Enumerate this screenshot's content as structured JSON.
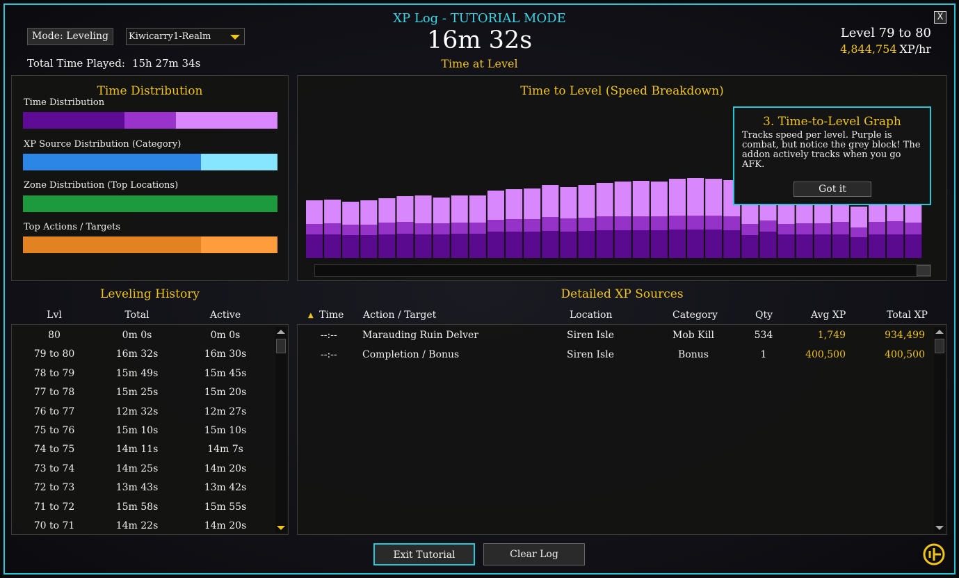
{
  "window": {
    "close_label": "X"
  },
  "header": {
    "title": "XP Log - TUTORIAL MODE",
    "time": "16m 32s",
    "subtitle": "Time at Level",
    "level_range": "Level 79 to 80",
    "xp_per_hour_value": "4,844,754",
    "xp_per_hour_unit": "XP/hr"
  },
  "controls": {
    "mode_label": "Mode: Leveling",
    "realm_selected": "Kiwicarry1-Realm",
    "total_played_label": "Total Time Played:",
    "total_played_value": "15h 27m 34s"
  },
  "distribution": {
    "title": "Time Distribution",
    "bars": [
      {
        "label": "Time Distribution",
        "segments": [
          {
            "fraction": 0.4,
            "color": "#5e0b96"
          },
          {
            "fraction": 0.2,
            "color": "#9a33cc"
          },
          {
            "fraction": 0.4,
            "color": "#da86ff"
          }
        ]
      },
      {
        "label": "XP Source Distribution (Category)",
        "segments": [
          {
            "fraction": 0.7,
            "color": "#2c86e6"
          },
          {
            "fraction": 0.3,
            "color": "#86e5ff"
          }
        ]
      },
      {
        "label": "Zone Distribution (Top Locations)",
        "segments": [
          {
            "fraction": 1.0,
            "color": "#1d9a3e"
          }
        ]
      },
      {
        "label": "Top Actions / Targets",
        "segments": [
          {
            "fraction": 0.7,
            "color": "#e38220"
          },
          {
            "fraction": 0.3,
            "color": "#ff9d3c"
          }
        ]
      }
    ]
  },
  "chart_data": {
    "type": "bar",
    "title": "Time to Level (Speed Breakdown)",
    "stacked": true,
    "series": [
      {
        "color": "#5a0a8e",
        "values": [
          34,
          34,
          33,
          33,
          34,
          35,
          34,
          34,
          35,
          35,
          38,
          38,
          38,
          39,
          38,
          39,
          40,
          40,
          40,
          40,
          41,
          41,
          41,
          40,
          33,
          38,
          34,
          34,
          34,
          34,
          30,
          34,
          34,
          34
        ]
      },
      {
        "color": "#9532c8",
        "values": [
          15,
          16,
          15,
          15,
          17,
          17,
          16,
          16,
          16,
          16,
          17,
          18,
          18,
          20,
          19,
          19,
          20,
          20,
          20,
          20,
          20,
          20,
          20,
          20,
          16,
          16,
          15,
          16,
          16,
          18,
          14,
          18,
          19,
          17
        ]
      },
      {
        "color": "#d987fd",
        "values": [
          34,
          34,
          33,
          35,
          35,
          37,
          40,
          37,
          39,
          39,
          42,
          43,
          44,
          46,
          45,
          47,
          48,
          50,
          51,
          50,
          53,
          54,
          53,
          52,
          40,
          38,
          38,
          40,
          40,
          38,
          30,
          37,
          36,
          37
        ]
      }
    ],
    "hidden_by_overlay": "bars under tutorial popup partly obscured"
  },
  "tutorial": {
    "title": "3. Time-to-Level Graph",
    "body": "Tracks speed per level. Purple is combat, but notice the grey block! The addon actively tracks when you go AFK.",
    "button": "Got it"
  },
  "history": {
    "title": "Leveling History",
    "columns": [
      "Lvl",
      "Total",
      "Active"
    ],
    "rows": [
      [
        "80",
        "0m 0s",
        "0m 0s"
      ],
      [
        "79 to 80",
        "16m 32s",
        "16m 30s"
      ],
      [
        "78 to 79",
        "15m 49s",
        "15m 45s"
      ],
      [
        "77 to 78",
        "15m 25s",
        "15m 20s"
      ],
      [
        "76 to 77",
        "12m 32s",
        "12m 27s"
      ],
      [
        "75 to 76",
        "15m 10s",
        "15m 10s"
      ],
      [
        "74 to 75",
        "14m 11s",
        "14m 7s"
      ],
      [
        "73 to 74",
        "14m 25s",
        "14m 20s"
      ],
      [
        "72 to 73",
        "13m 43s",
        "13m 42s"
      ],
      [
        "71 to 72",
        "15m 58s",
        "15m 55s"
      ],
      [
        "70 to 71",
        "14m 22s",
        "14m 20s"
      ]
    ]
  },
  "sources": {
    "title": "Detailed XP Sources",
    "columns": [
      "Time",
      "Action / Target",
      "Location",
      "Category",
      "Qty",
      "Avg XP",
      "Total XP"
    ],
    "rows": [
      [
        "--:--",
        "Marauding Ruin Delver",
        "Siren Isle",
        "Mob Kill",
        "534",
        "1,749",
        "934,499"
      ],
      [
        "--:--",
        "Completion / Bonus",
        "Siren Isle",
        "Bonus",
        "1",
        "400,500",
        "400,500"
      ]
    ]
  },
  "footer": {
    "exit_label": "Exit Tutorial",
    "clear_label": "Clear Log"
  },
  "colors": {
    "accent": "#25c8d6",
    "gold": "#f0c419"
  }
}
